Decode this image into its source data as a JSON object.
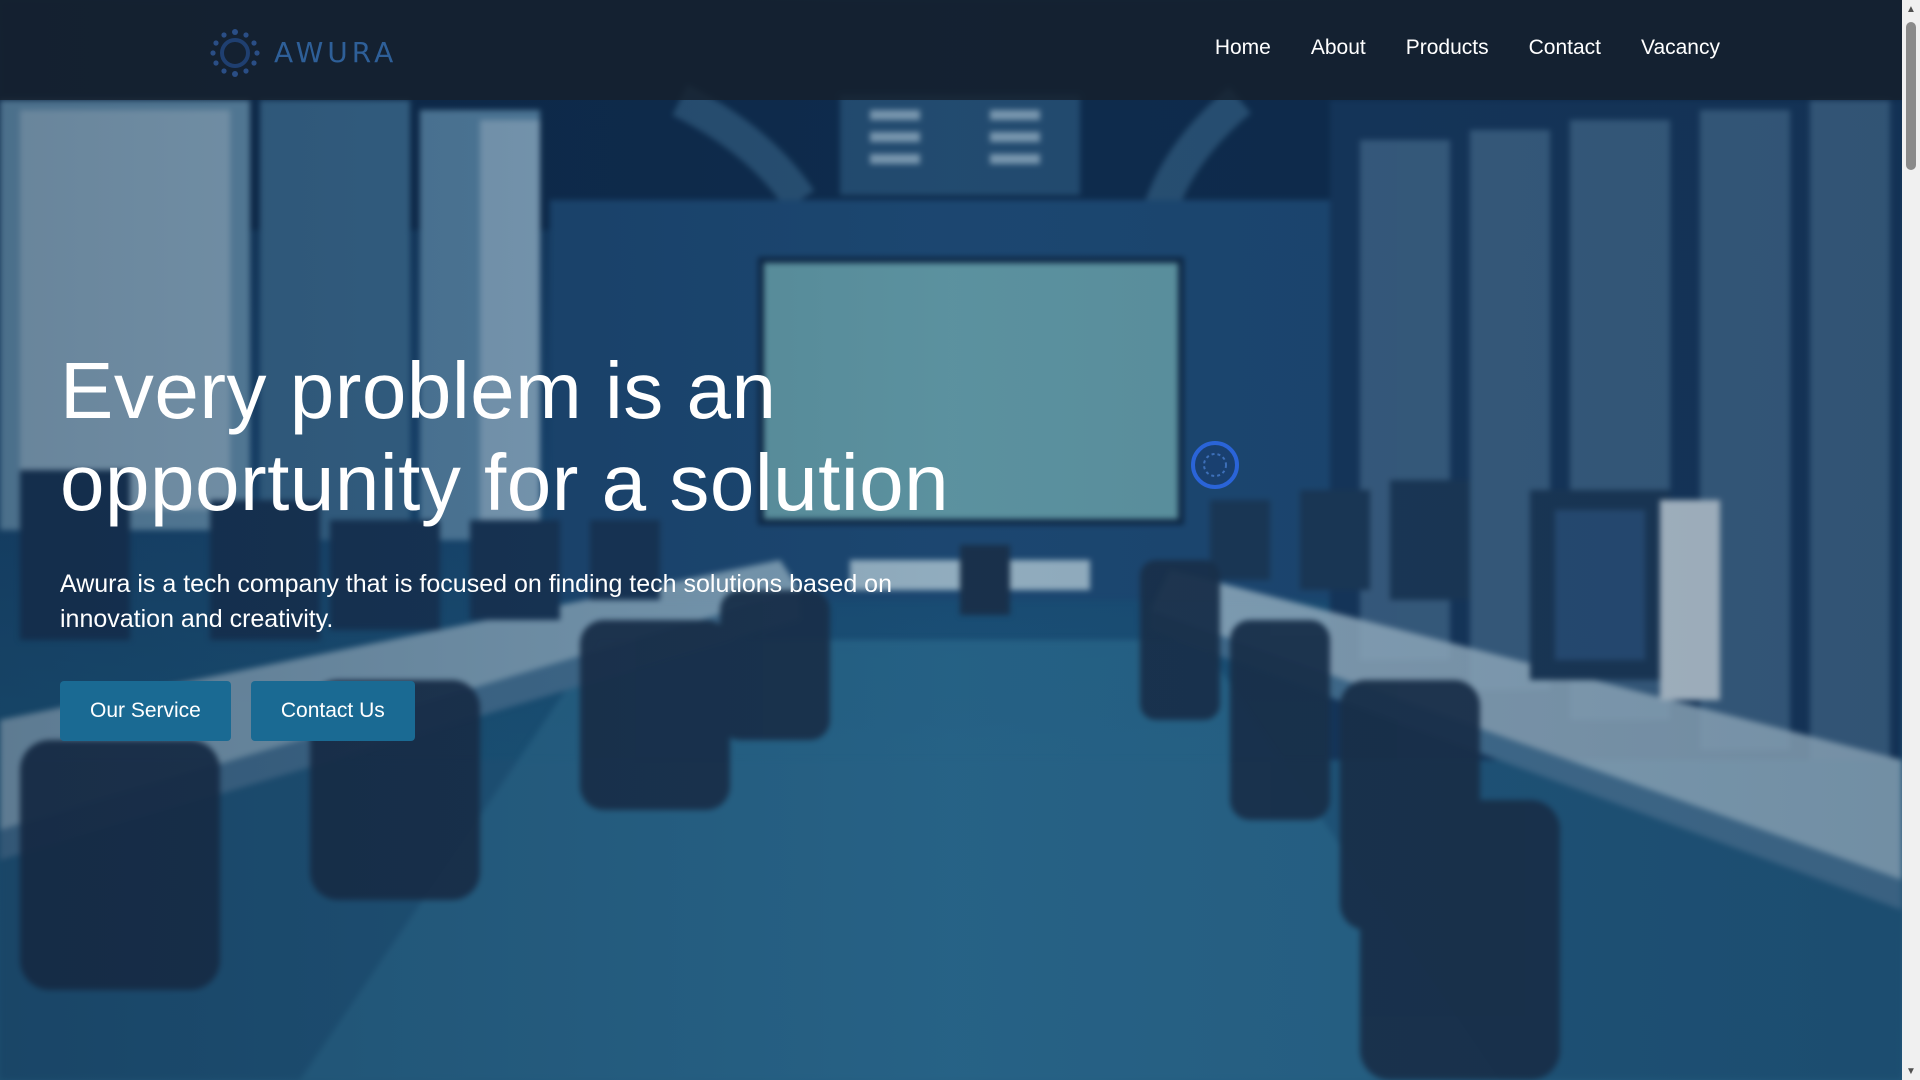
{
  "header": {
    "logo_text": "AWURA",
    "nav": [
      {
        "label": "Home"
      },
      {
        "label": "About"
      },
      {
        "label": "Products"
      },
      {
        "label": "Contact"
      },
      {
        "label": "Vacancy"
      }
    ]
  },
  "hero": {
    "title": "Every problem is an opportunity for a solution",
    "subtitle": "Awura is a tech company that is focused on finding tech solutions based on innovation and creativity.",
    "buttons": {
      "primary": "Our Service",
      "secondary": "Contact Us"
    }
  },
  "colors": {
    "header_bg": "#16202c",
    "logo": "#2e5f98",
    "button_bg": "#1a6a93",
    "text": "#ffffff",
    "loader_ring": "#2a64d8"
  },
  "icons": {
    "logo": "awura-logo-icon",
    "loader": "loading-spinner-icon",
    "scroll_up": "chevron-up-icon",
    "scroll_down": "chevron-down-icon"
  },
  "background": {
    "image": "office-computer-lab-photo"
  }
}
